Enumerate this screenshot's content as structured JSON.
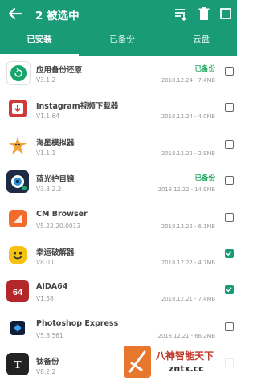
{
  "header": {
    "title": "2 被选中",
    "back_icon": "back-arrow-icon",
    "actions": [
      "sort-icon",
      "trash-icon",
      "select-all-icon"
    ],
    "background": "#1a9b78"
  },
  "tabs": [
    {
      "label": "已安装",
      "active": true
    },
    {
      "label": "已备份",
      "active": false
    },
    {
      "label": "云盘",
      "active": false
    }
  ],
  "apps": [
    {
      "name": "应用备份还原",
      "version": "V3.1.2",
      "status": "已备份",
      "meta": "2018.12.24 - 7.4MB",
      "checked": false,
      "icon": "backup-restore-icon",
      "color": "#17a56c"
    },
    {
      "name": "Instagram视频下载器",
      "version": "V1.1.64",
      "status": "",
      "meta": "2018.12.24 - 4.0MB",
      "checked": false,
      "icon": "video-downloader-icon",
      "color": "#d03a3a"
    },
    {
      "name": "海星模拟器",
      "version": "V1.1.1",
      "status": "",
      "meta": "2018.12.22 - 2.9MB",
      "checked": false,
      "icon": "starfish-icon",
      "color": "#f1a33a"
    },
    {
      "name": "蓝光护目镜",
      "version": "V3.3.2.2",
      "status": "已备份",
      "meta": "2018.12.22 - 14.9MB",
      "checked": false,
      "icon": "eye-filter-icon",
      "color": "#1f2a44"
    },
    {
      "name": "CM Browser",
      "version": "V5.22.20.0013",
      "status": "",
      "meta": "2018.12.22 - 6.1MB",
      "checked": false,
      "icon": "cm-browser-icon",
      "color": "#f36b2a"
    },
    {
      "name": "幸运破解器",
      "version": "V8.0.0",
      "status": "",
      "meta": "2018.12.22 - 4.7MB",
      "checked": true,
      "icon": "smiley-icon",
      "color": "#f5c20f"
    },
    {
      "name": "AIDA64",
      "version": "V1.58",
      "status": "",
      "meta": "2018.12.21 - 7.4MB",
      "checked": true,
      "icon": "aida64-icon",
      "color": "#b3262a"
    },
    {
      "name": "Photoshop Express",
      "version": "V5.8.561",
      "status": "",
      "meta": "2018.12.21 - 66.2MB",
      "checked": false,
      "icon": "photoshop-icon",
      "color": "#0f1d36"
    },
    {
      "name": "钛备份",
      "version": "V8.2.2",
      "status": "",
      "meta": "",
      "checked": false,
      "icon": "titanium-backup-icon",
      "color": "#222222"
    }
  ],
  "watermark": {
    "line1": "八神智能天下",
    "line2": "zntx.cc"
  }
}
